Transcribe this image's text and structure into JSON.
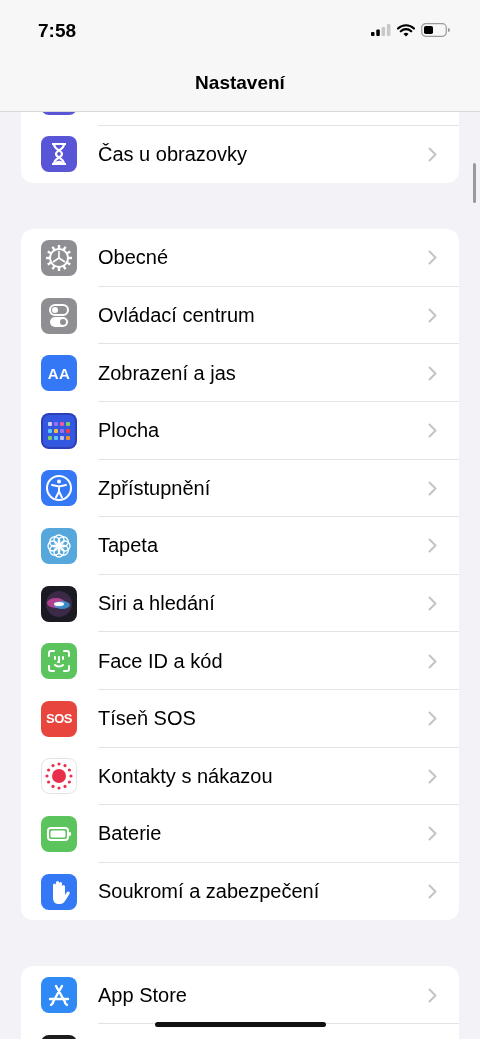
{
  "status_bar": {
    "time": "7:58"
  },
  "nav_bar": {
    "title": "Nastavení"
  },
  "groups": [
    {
      "items": [
        {
          "kind": "cut"
        },
        {
          "kind": "row",
          "label": "Čas u obrazovky"
        }
      ]
    },
    {
      "items": [
        {
          "kind": "row",
          "label": "Obecné"
        },
        {
          "kind": "row",
          "label": "Ovládací centrum"
        },
        {
          "kind": "row",
          "label": "Zobrazení a jas",
          "badge": "AA"
        },
        {
          "kind": "row",
          "label": "Plocha"
        },
        {
          "kind": "row",
          "label": "Zpřístupnění"
        },
        {
          "kind": "row",
          "label": "Tapeta"
        },
        {
          "kind": "row",
          "label": "Siri a hledání"
        },
        {
          "kind": "row",
          "label": "Face ID a kód"
        },
        {
          "kind": "row",
          "label": "Tíseň SOS",
          "badge": "SOS"
        },
        {
          "kind": "row",
          "label": "Kontakty s nákazou"
        },
        {
          "kind": "row",
          "label": "Baterie"
        },
        {
          "kind": "row",
          "label": "Soukromí a zabezpečení"
        }
      ]
    },
    {
      "items": [
        {
          "kind": "row",
          "label": "App Store"
        },
        {
          "kind": "cut"
        }
      ]
    }
  ]
}
